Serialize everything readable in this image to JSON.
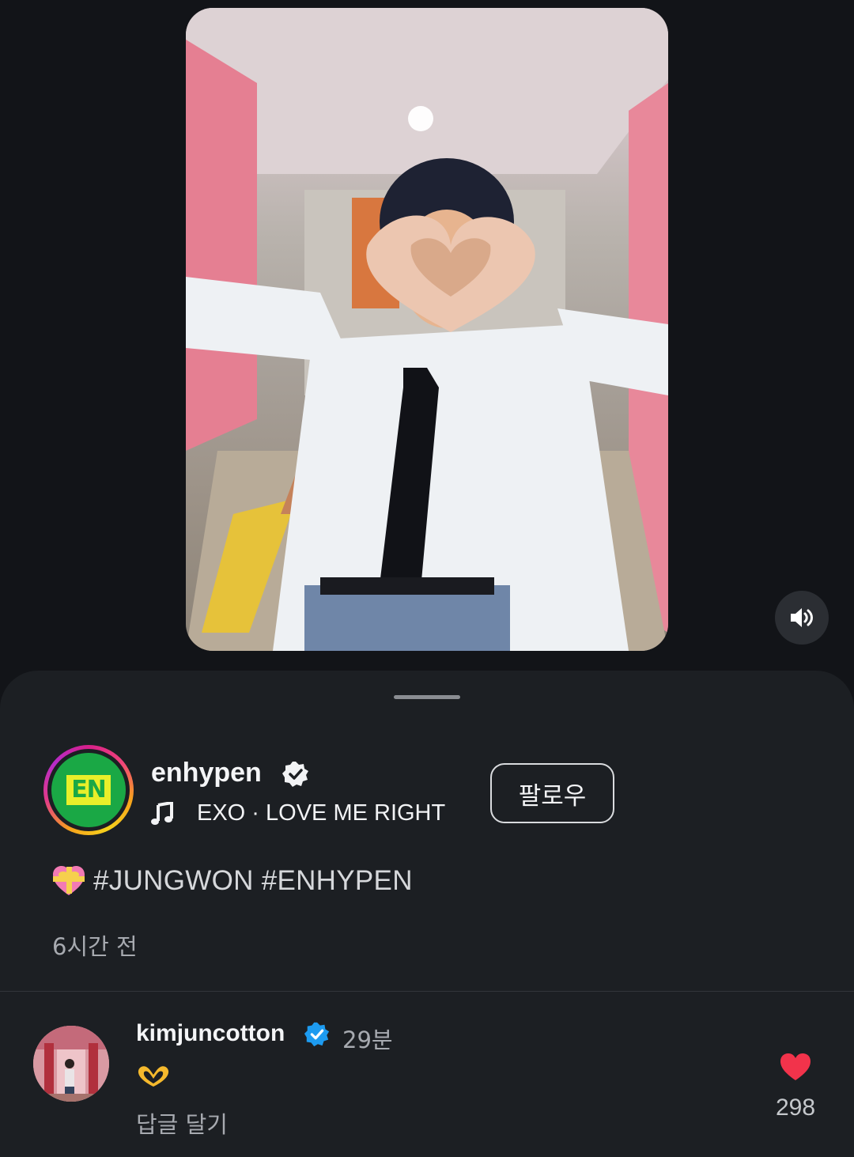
{
  "video": {
    "sound_icon": "speaker-on-icon"
  },
  "post": {
    "username": "enhypen",
    "avatar_text": "EN",
    "verified_icon": "verified-badge-icon",
    "music_icon": "music-note-icon",
    "music": "EXO · LOVE ME RIGHT",
    "follow_label": "팔로우",
    "caption_emoji": "heart-with-ribbon-emoji",
    "caption": "#JUNGWON #ENHYPEN",
    "time": "6시간 전"
  },
  "comment": {
    "username": "kimjuncotton",
    "time": "29분",
    "body_emoji": "heart-hands-emoji",
    "reply_label": "답글 달기",
    "like_icon": "heart-icon",
    "like_count": "298"
  },
  "colors": {
    "background": "#121418",
    "sheet": "#1c1f23",
    "verified_blue": "#1d9bf0",
    "like_red": "#f2334b"
  }
}
